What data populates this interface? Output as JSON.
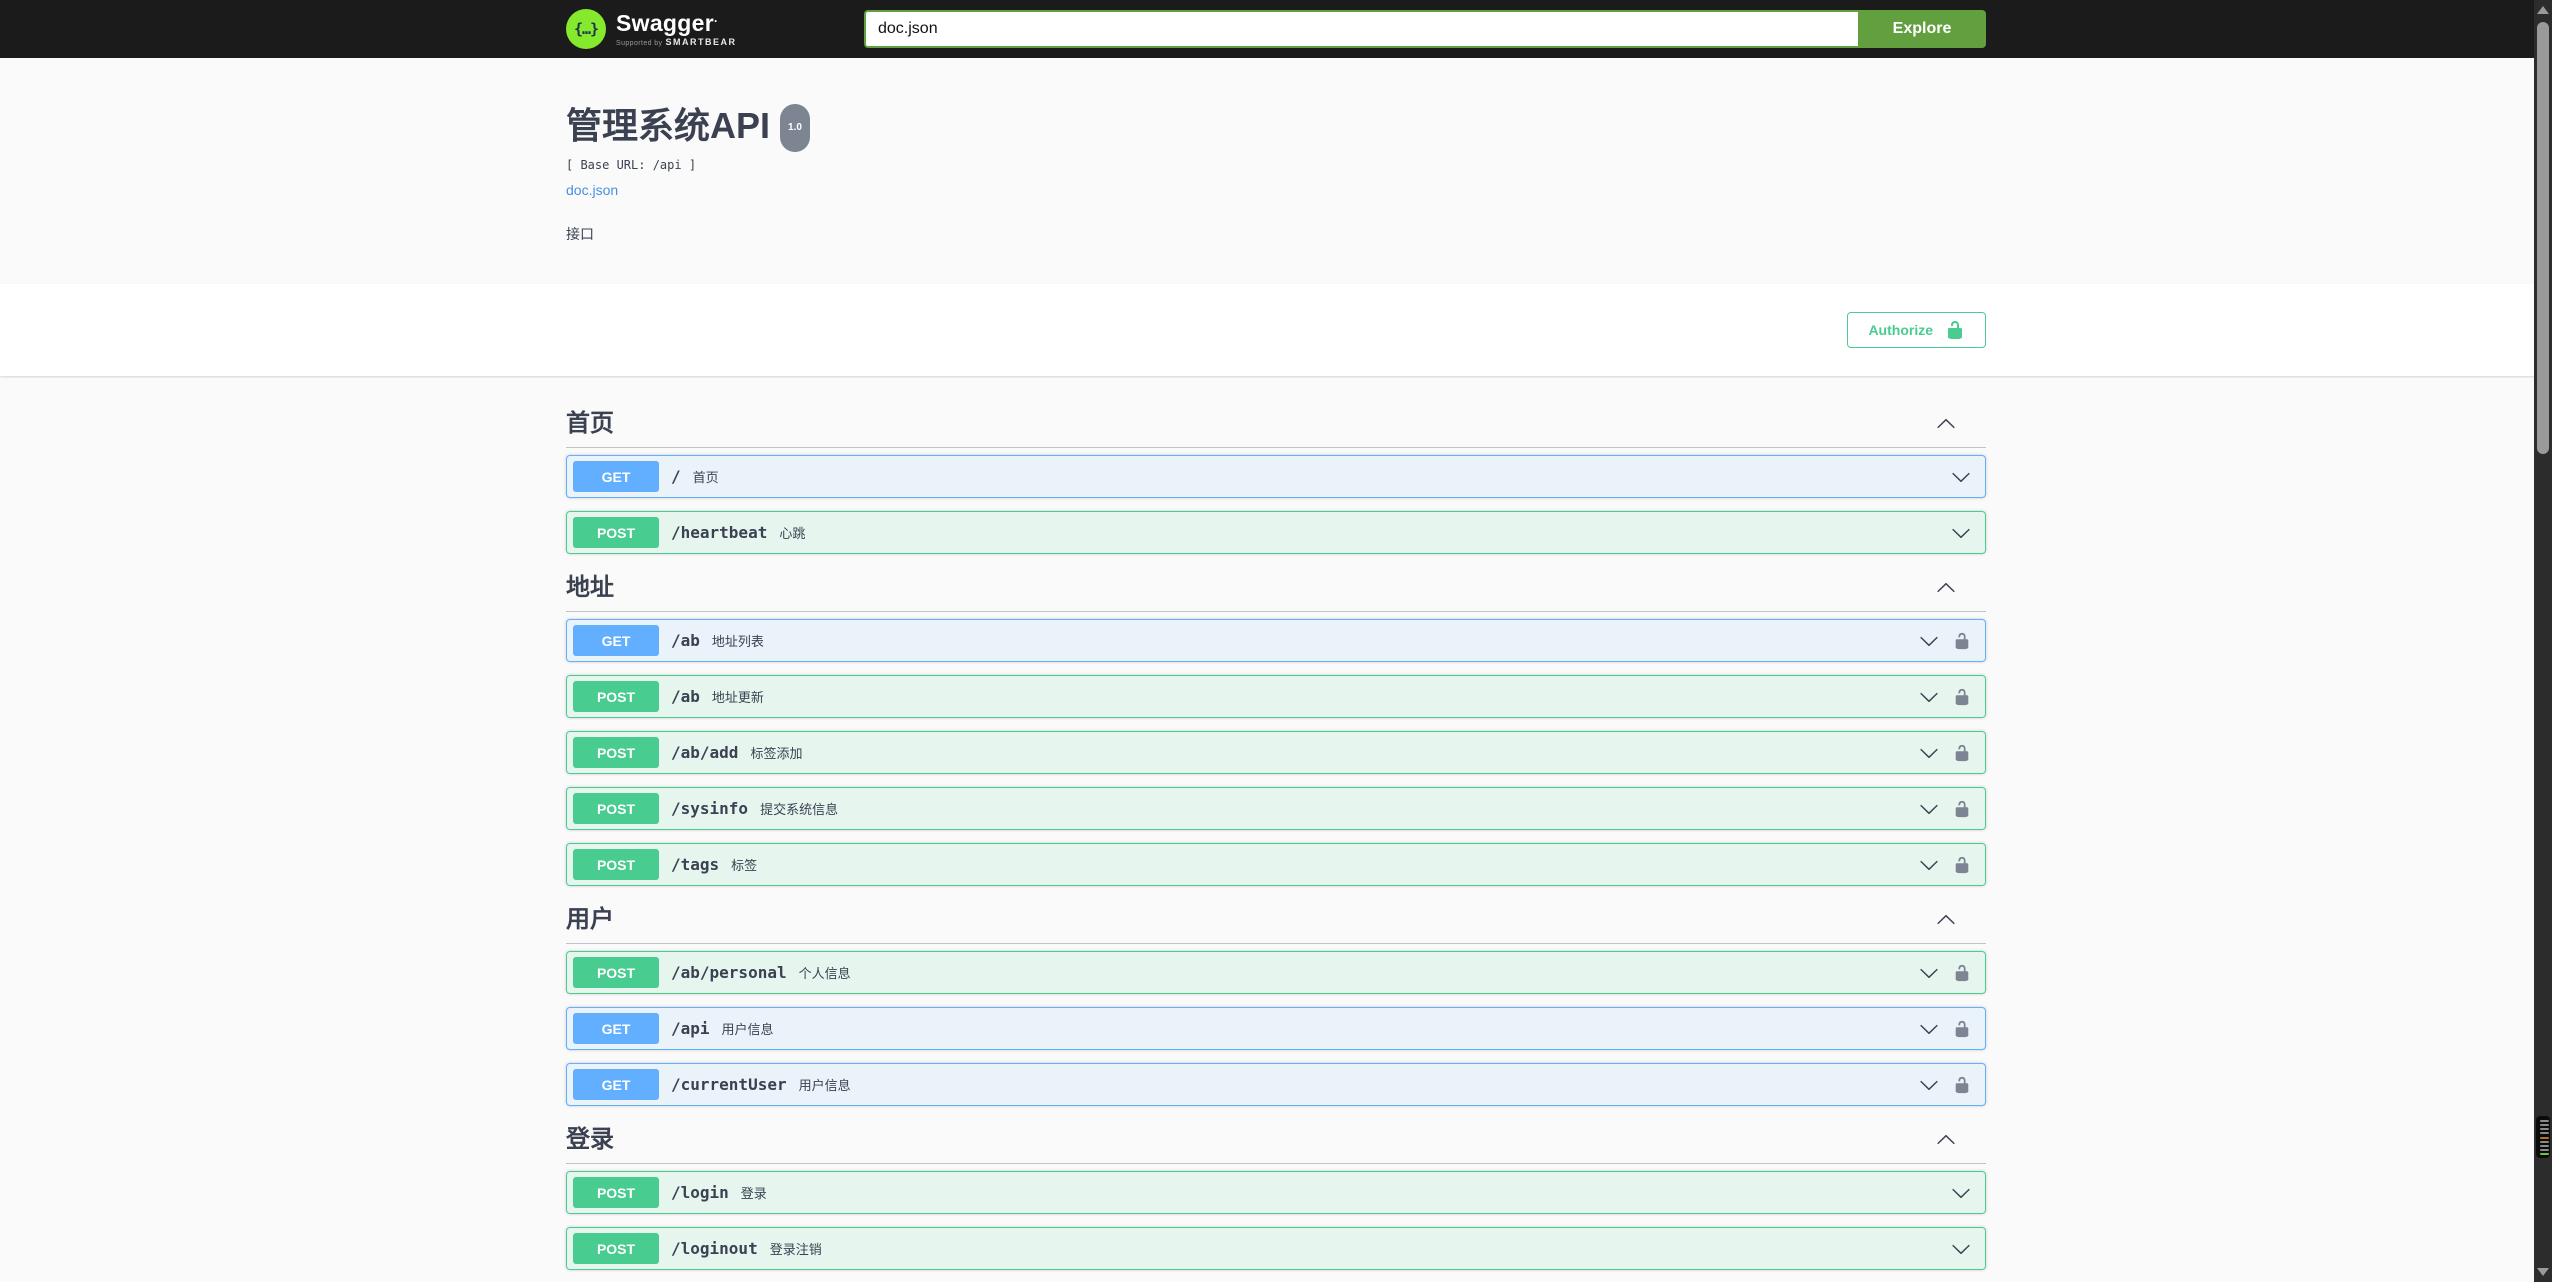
{
  "topbar": {
    "logo_glyph": "{…}",
    "brand": "Swagger",
    "brand_mark": ".",
    "supported_by_prefix": "Supported by",
    "supported_by_brand": "SMARTBEAR",
    "search_value": "doc.json",
    "explore_label": "Explore",
    "bar_color": "#1b1b1b",
    "accent_green": "#62a03f",
    "logo_green": "#85ea2d"
  },
  "info": {
    "title": "管理系统API",
    "version_badge": "1.0",
    "base_url_text": "[ Base URL: /api ]",
    "spec_link_label": "doc.json",
    "description": "接口"
  },
  "auth": {
    "authorize_label": "Authorize",
    "accent": "#49cc90"
  },
  "methods": {
    "GET": {
      "badge_bg": "#61affe",
      "row_bg": "rgba(97,175,254,0.1)",
      "border": "#61affe"
    },
    "POST": {
      "badge_bg": "#49cc90",
      "row_bg": "rgba(73,204,144,0.1)",
      "border": "#49cc90"
    }
  },
  "sections": [
    {
      "title": "首页",
      "operations": [
        {
          "method": "GET",
          "path": "/",
          "summary": "首页",
          "lock": false
        },
        {
          "method": "POST",
          "path": "/heartbeat",
          "summary": "心跳",
          "lock": false
        }
      ]
    },
    {
      "title": "地址",
      "operations": [
        {
          "method": "GET",
          "path": "/ab",
          "summary": "地址列表",
          "lock": true
        },
        {
          "method": "POST",
          "path": "/ab",
          "summary": "地址更新",
          "lock": true
        },
        {
          "method": "POST",
          "path": "/ab/add",
          "summary": "标签添加",
          "lock": true
        },
        {
          "method": "POST",
          "path": "/sysinfo",
          "summary": "提交系统信息",
          "lock": true
        },
        {
          "method": "POST",
          "path": "/tags",
          "summary": "标签",
          "lock": true
        }
      ]
    },
    {
      "title": "用户",
      "operations": [
        {
          "method": "POST",
          "path": "/ab/personal",
          "summary": "个人信息",
          "lock": true
        },
        {
          "method": "GET",
          "path": "/api",
          "summary": "用户信息",
          "lock": true
        },
        {
          "method": "GET",
          "path": "/currentUser",
          "summary": "用户信息",
          "lock": true
        }
      ]
    },
    {
      "title": "登录",
      "operations": [
        {
          "method": "POST",
          "path": "/login",
          "summary": "登录",
          "lock": false
        },
        {
          "method": "POST",
          "path": "/loginout",
          "summary": "登录注销",
          "lock": false
        }
      ]
    }
  ],
  "scrollbar": {
    "track_color": "#2c2c2c",
    "thumb_color": "#9a9a9a",
    "minimap_line_colors": [
      "#8a8a8a",
      "#8a8a8a",
      "#8a8a8a",
      "#8a8a8a",
      "#b5722d",
      "#8a8a8a",
      "#8a8a8a",
      "#8a8a8a",
      "#6fc43c"
    ]
  }
}
